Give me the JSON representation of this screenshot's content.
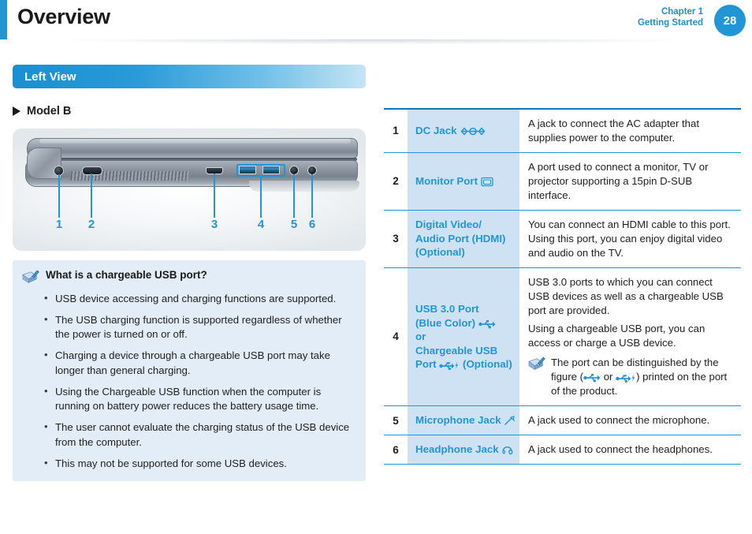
{
  "header": {
    "title": "Overview",
    "chapter_line1": "Chapter 1",
    "chapter_line2": "Getting Started",
    "page_number": "28",
    "accent_color": "#2196d6"
  },
  "section": {
    "title": "Left View",
    "model_label": "Model B"
  },
  "figure": {
    "callouts": [
      "1",
      "2",
      "3",
      "4",
      "5",
      "6"
    ],
    "alt": "Left side view of laptop showing ports"
  },
  "note_box": {
    "title": "What is a chargeable USB port?",
    "items": [
      "USB device accessing and charging functions are supported.",
      "The USB charging function is supported regardless of whether the power is turned on or off.",
      "Charging a device through a chargeable USB port may take longer than general charging.",
      "Using the Chargeable USB function when the computer is running on battery power reduces the battery usage time.",
      "The user cannot evaluate the charging status of the USB device from the computer.",
      "This may not be supported for some USB devices."
    ]
  },
  "spec_table": {
    "rows": [
      {
        "num": "1",
        "name": "DC Jack",
        "name_icon": "dc-jack-icon",
        "desc": [
          "A jack to connect the AC adapter that supplies power to the computer."
        ]
      },
      {
        "num": "2",
        "name": "Monitor Port",
        "name_icon": "monitor-port-icon",
        "desc": [
          "A port used to connect a monitor, TV or projector supporting a 15pin D-SUB interface."
        ]
      },
      {
        "num": "3",
        "name": "Digital Video/ Audio Port (HDMI) (Optional)",
        "name_line1": "Digital Video/",
        "name_line2": "Audio Port (HDMI)",
        "name_line3": "(Optional)",
        "desc": [
          "You can connect an HDMI cable to this port. Using this port, you can enjoy digital video and audio on the TV."
        ]
      },
      {
        "num": "4",
        "name_line1": "USB 3.0 Port",
        "name_line2": "(Blue Color)",
        "name_line3": "or",
        "name_line4": "Chargeable USB",
        "name_line5": "Port",
        "name_line5_suffix": "(Optional)",
        "desc": [
          "USB 3.0 ports to which you can connect USB devices as well as a chargeable USB port are provided.",
          "Using a chargeable USB port, you can access or charge a USB device."
        ],
        "subnote": {
          "text_before": "The port can be distinguished by the figure (",
          "text_middle": " or ",
          "text_after": ") printed on the port of the product."
        }
      },
      {
        "num": "5",
        "name": "Microphone Jack",
        "name_icon": "microphone-icon",
        "desc": [
          "A jack used to connect the microphone."
        ]
      },
      {
        "num": "6",
        "name": "Headphone Jack",
        "name_icon": "headphone-icon",
        "desc": [
          "A jack used to connect the headphones."
        ]
      }
    ]
  },
  "colors": {
    "brand_blue": "#2196d6",
    "table_name_bg": "#cfe2f3",
    "note_bg": "#e2edf7",
    "rule_blue": "#1276b5"
  }
}
